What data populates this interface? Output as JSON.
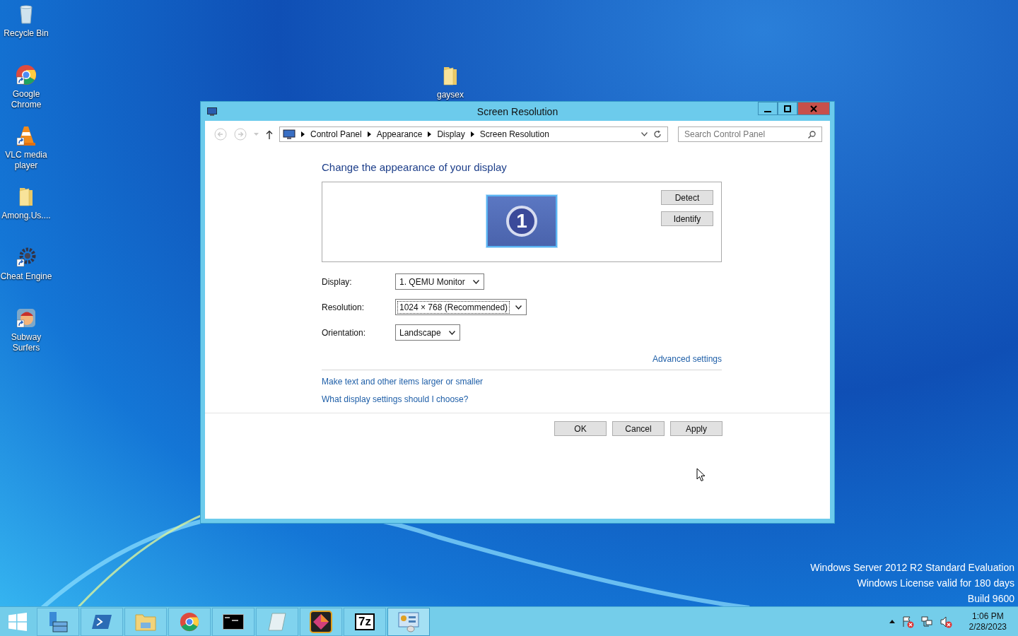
{
  "desktop_icons": [
    {
      "label": "Recycle Bin",
      "kind": "bin",
      "shortcut": false
    },
    {
      "label": "Google Chrome",
      "kind": "chrome",
      "shortcut": true
    },
    {
      "label": "VLC media player",
      "kind": "cone",
      "shortcut": true
    },
    {
      "label": "Among.Us....",
      "kind": "folder",
      "shortcut": false
    },
    {
      "label": "Cheat Engine",
      "kind": "gear",
      "shortcut": true
    },
    {
      "label": "Subway Surfers",
      "kind": "game",
      "shortcut": true
    }
  ],
  "desktop_free_icons": [
    {
      "label": "gaysex",
      "kind": "folder"
    }
  ],
  "window": {
    "title": "Screen Resolution",
    "nav_buttons": [
      {
        "kind": "back",
        "disabled": true
      },
      {
        "kind": "forward",
        "disabled": true
      },
      {
        "kind": "recent",
        "disabled": true
      },
      {
        "kind": "up",
        "disabled": false
      }
    ],
    "breadcrumbs": [
      "Control Panel",
      "Appearance",
      "Display",
      "Screen Resolution"
    ],
    "search": {
      "placeholder": "Search Control Panel"
    },
    "heading": "Change the appearance of your display",
    "monitor": {
      "number": "1",
      "selected": true
    },
    "preview_buttons": [
      "Detect",
      "Identify"
    ],
    "fields": [
      {
        "label": "Display:",
        "value": "1. QEMU Monitor",
        "focused": false
      },
      {
        "label": "Resolution:",
        "value": "1024 × 768 (Recommended)",
        "focused": true
      },
      {
        "label": "Orientation:",
        "value": "Landscape",
        "focused": false
      }
    ],
    "advanced_link": "Advanced settings",
    "links": [
      "Make text and other items larger or smaller",
      "What display settings should I choose?"
    ],
    "buttons": [
      "OK",
      "Cancel",
      "Apply"
    ]
  },
  "watermark": [
    "Windows Server 2012 R2 Standard Evaluation",
    "Windows License valid for 180 days",
    "Build 9600"
  ],
  "taskbar": {
    "apps": [
      {
        "kind": "server"
      },
      {
        "kind": "shell"
      },
      {
        "kind": "explorer"
      },
      {
        "kind": "chrome"
      },
      {
        "kind": "terminal"
      },
      {
        "kind": "notepad"
      },
      {
        "kind": "diamond"
      },
      {
        "kind": "zip",
        "text": "7z"
      },
      {
        "kind": "panel",
        "active": true
      }
    ],
    "tray": [
      {
        "kind": "flag"
      },
      {
        "kind": "network"
      },
      {
        "kind": "speaker"
      }
    ],
    "time": "1:06 PM",
    "date": "2/28/2023"
  }
}
